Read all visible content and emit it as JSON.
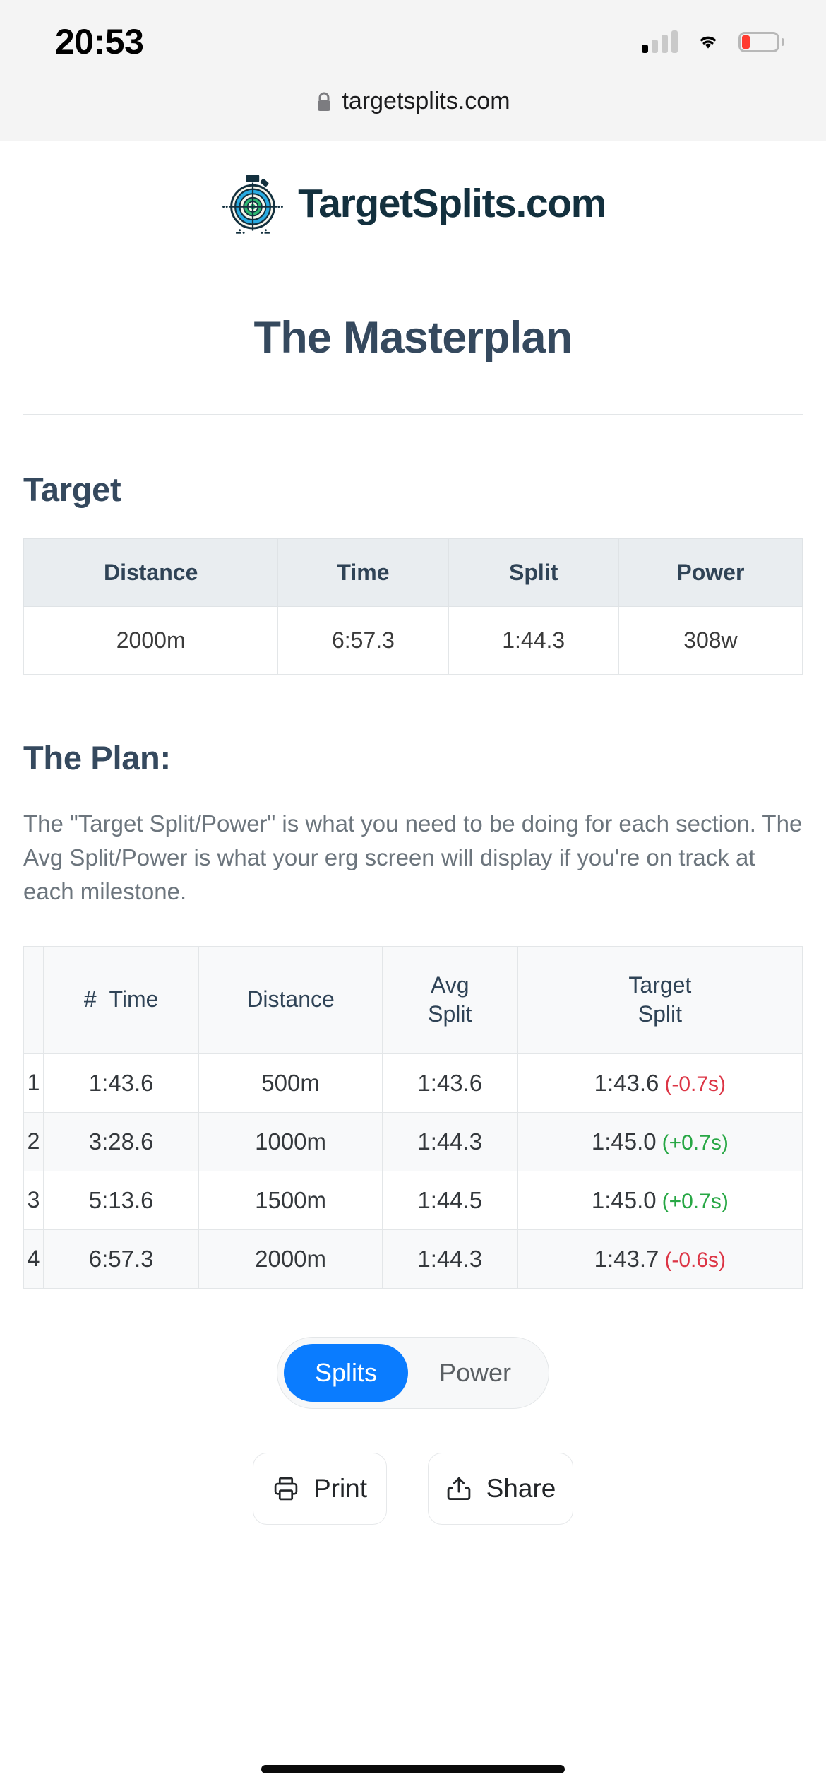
{
  "status_bar": {
    "time": "20:53",
    "signal_icon": "cellular-signal-icon",
    "signal_bars_filled": 1,
    "signal_bars_total": 4,
    "wifi_icon": "wifi-icon",
    "battery_icon": "battery-low-icon",
    "battery_color": "#ff3b30"
  },
  "browser": {
    "lock_icon": "lock-icon",
    "url": "targetsplits.com"
  },
  "site": {
    "logo_icon": "target-stopwatch-icon",
    "logo_text": "TargetSplits.com",
    "logo_color": "#13303e",
    "accent_blue": "#29abe2",
    "accent_green": "#2eb872"
  },
  "page": {
    "title": "The Masterplan",
    "target_section_title": "Target",
    "plan_section_title": "The Plan:",
    "plan_description": "The \"Target Split/Power\" is what you need to be doing for each section. The Avg Split/Power is what your erg screen will display if you're on track at each milestone."
  },
  "target_table": {
    "headers": [
      "Distance",
      "Time",
      "Split",
      "Power"
    ],
    "row": [
      "2000m",
      "6:57.3",
      "1:44.3",
      "308w"
    ]
  },
  "splits_table": {
    "headers": {
      "num": "#",
      "time": "Time",
      "distance": "Distance",
      "avg_split": "Avg Split",
      "avg_split_line1": "Avg",
      "avg_split_line2": "Split",
      "target_split": "Target Split",
      "target_split_line1": "Target",
      "target_split_line2": "Split"
    },
    "rows": [
      {
        "num": "1",
        "time": "1:43.6",
        "distance": "500m",
        "avg_split": "1:43.6",
        "target_split": "1:43.6",
        "delta": "(-0.7s)",
        "delta_sign": "neg"
      },
      {
        "num": "2",
        "time": "3:28.6",
        "distance": "1000m",
        "avg_split": "1:44.3",
        "target_split": "1:45.0",
        "delta": "(+0.7s)",
        "delta_sign": "pos"
      },
      {
        "num": "3",
        "time": "5:13.6",
        "distance": "1500m",
        "avg_split": "1:44.5",
        "target_split": "1:45.0",
        "delta": "(+0.7s)",
        "delta_sign": "pos"
      },
      {
        "num": "4",
        "time": "6:57.3",
        "distance": "2000m",
        "avg_split": "1:44.3",
        "target_split": "1:43.7",
        "delta": "(-0.6s)",
        "delta_sign": "neg"
      }
    ],
    "delta_negative_color": "#dc3545",
    "delta_positive_color": "#28a745"
  },
  "toggle": {
    "splits_label": "Splits",
    "power_label": "Power",
    "selected": "Splits",
    "active_color": "#0a7cff"
  },
  "actions": {
    "print_label": "Print",
    "print_icon": "printer-icon",
    "share_label": "Share",
    "share_icon": "share-upload-icon"
  }
}
